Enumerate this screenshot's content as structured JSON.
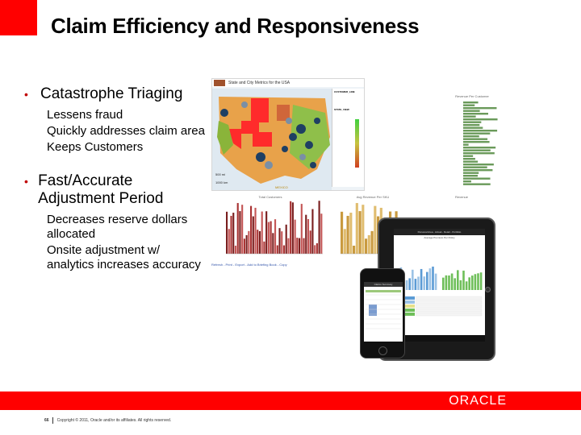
{
  "slide": {
    "title": "Claim Efficiency and Responsiveness",
    "accent_color": "#ff0000",
    "bullets": [
      {
        "text": "Catastrophe Triaging",
        "subs": [
          "Lessens fraud",
          "Quickly addresses claim area",
          "Keeps Customers"
        ]
      },
      {
        "text": "Fast/Accurate Adjustment Period",
        "subs": [
          "Decreases reserve dollars allocated",
          "Onsite adjustment w/ analytics increases accuracy"
        ]
      }
    ]
  },
  "dashboard": {
    "map_title": "State and City Metrics for the USA",
    "map_label_mexico": "MEXICO",
    "scale_1": "500 mi",
    "scale_2": "1000 km",
    "legend_title_1": "CUSTOMER_LINE",
    "legend_title_2": "STATE_VIEW",
    "bar_panel_title": "Revenue Per Customer",
    "chart1_title": "Total Customers",
    "chart2_title": "Avg Revenue Per SKU",
    "chart3_title": "Revenue",
    "links": "Refresh - Print - Export - Add to Briefing Book - Copy"
  },
  "devices": {
    "ipad_header": "Personal Area - Actual - Detail - Portfolio",
    "ipad_subheader": "Average Premium Per Policy",
    "iphone_header": "Claims Summary"
  },
  "footer": {
    "page_number": "66",
    "copyright": "Copyright © 2011, Oracle and/or its affiliates. All rights reserved.",
    "logo": "ORACLE"
  }
}
